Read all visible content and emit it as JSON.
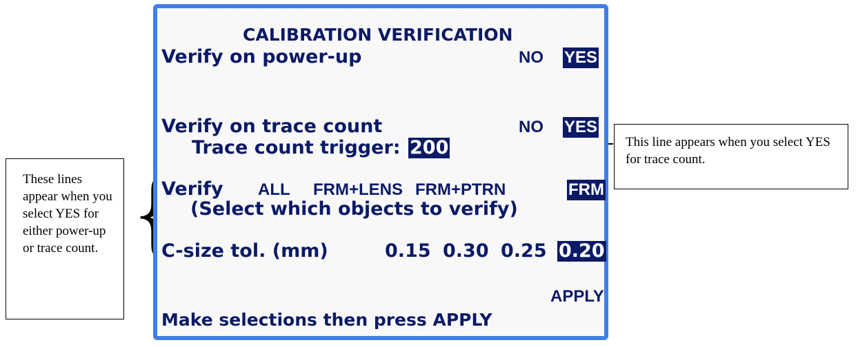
{
  "screen": {
    "title": "CALIBRATION VERIFICATION",
    "power_up": {
      "label": "Verify on power-up",
      "no": "NO",
      "yes": "YES",
      "selected": "YES"
    },
    "trace_count": {
      "label": "Verify on trace count",
      "no": "NO",
      "yes": "YES",
      "selected": "YES"
    },
    "trigger": {
      "label": "Trace count trigger:",
      "value": "200"
    },
    "verify": {
      "label": "Verify",
      "options": [
        "ALL",
        "FRM+LENS",
        "FRM+PTRN",
        "FRM"
      ],
      "selected": "FRM",
      "hint": "(Select which objects to verify)"
    },
    "csize": {
      "label": "C-size tol. (mm)",
      "options": [
        "0.15",
        "0.30",
        "0.25",
        "0.20"
      ],
      "selected": "0.20"
    },
    "apply": "APPLY",
    "status": "Make selections then press APPLY"
  },
  "callouts": {
    "left": "These lines appear when you select YES for either power-up or trace count.",
    "right": "This line appears when you select YES for trace count."
  },
  "colors": {
    "screen_border": "#3f7fe6",
    "text": "#0b1a66",
    "highlight_bg": "#0b1a66"
  }
}
